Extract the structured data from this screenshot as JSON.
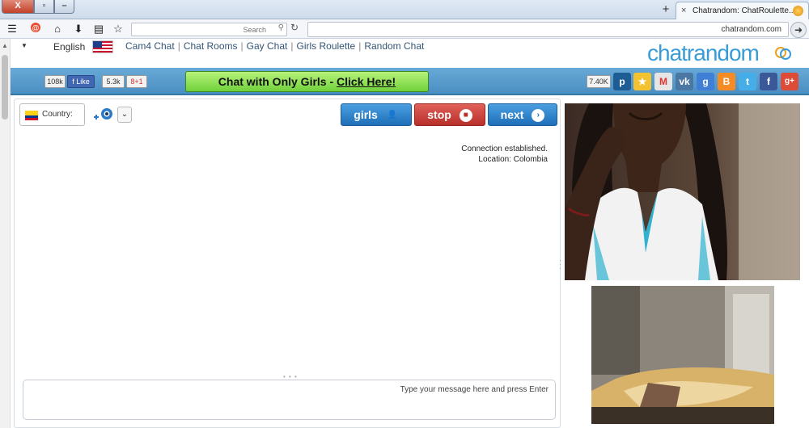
{
  "browser": {
    "tab_title": "Chatrandom: ChatRoulette...",
    "tab_close": "×",
    "new_tab": "+",
    "url": "chatrandom.com",
    "search_placeholder": "Search",
    "window_close": "X",
    "window_max": "▫",
    "window_min": "–"
  },
  "header": {
    "logo_text": "chatrandom",
    "language": "English",
    "top_links": [
      "Random Chat",
      "Girls Roulette",
      "Gay Chat",
      "Chat Rooms",
      "Cam4 Chat"
    ]
  },
  "bar": {
    "promo_prefix": "Chat with Only Girls - ",
    "promo_link": "Click Here!",
    "like_label": "Like",
    "like_count": "108k",
    "plus_label": "8+1",
    "plus_count": "5.3k",
    "social_count": "7.40K"
  },
  "controls": {
    "country_label": "Country:",
    "girls_label": "girls",
    "stop_label": "stop",
    "next_label": "next"
  },
  "chat": {
    "status_connected": "Connection established.",
    "status_location": "Location: Colombia",
    "message_placeholder": "Type your message here and press Enter"
  },
  "colors": {
    "accent_blue": "#4a8fc2",
    "stop_red": "#b8302a",
    "promo_green": "#6fd13a",
    "logo_blue": "#3a9cd6"
  }
}
